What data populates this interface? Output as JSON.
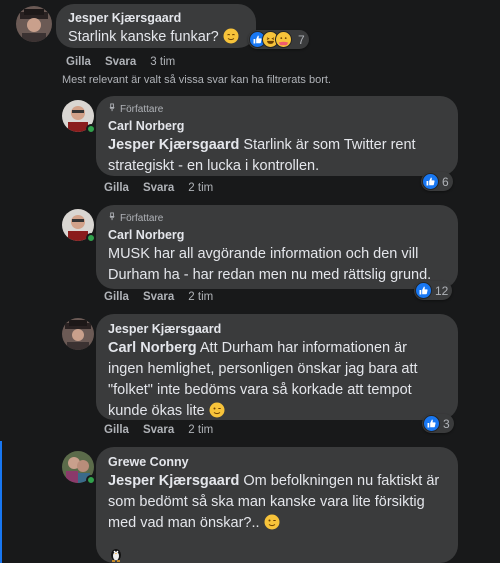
{
  "top_comment": {
    "author": "Jesper Kjærsgaard",
    "text": "Starlink kanske funkar?",
    "reaction_count": "7",
    "reaction_icons": [
      "like-icon",
      "laugh-icon",
      "care-icon"
    ],
    "actions": {
      "like": "Gilla",
      "reply": "Svara",
      "time": "3 tim"
    }
  },
  "filter_notice": "Mest relevant är valt så vissa svar kan ha filtrerats bort.",
  "replies": [
    {
      "badge": "Författare",
      "author": "Carl Norberg",
      "mention": "Jesper Kjærsgaard",
      "text": "Starlink är som Twitter rent strategiskt - en lucka i kontrollen.",
      "reaction_count": "6",
      "actions": {
        "like": "Gilla",
        "reply": "Svara",
        "time": "2 tim"
      }
    },
    {
      "badge": "Författare",
      "author": "Carl Norberg",
      "mention": "",
      "text": "MUSK har all avgörande information och den vill Durham ha - har redan men nu med rättslig grund.",
      "reaction_count": "12",
      "actions": {
        "like": "Gilla",
        "reply": "Svara",
        "time": "2 tim"
      }
    },
    {
      "badge": "",
      "author": "Jesper Kjærsgaard",
      "mention": "Carl Norberg",
      "text": "Att Durham har informationen är ingen hemlighet, personligen önskar jag bara att \"folket\" inte bedöms vara så korkade att tempot kunde ökas lite",
      "reaction_count": "3",
      "actions": {
        "like": "Gilla",
        "reply": "Svara",
        "time": "2 tim"
      }
    },
    {
      "badge": "",
      "author": "Grewe Conny",
      "mention": "Jesper Kjærsgaard",
      "text": "Om befolkningen nu faktiskt är som bedömt så ska man kanske vara lite försiktig med vad man önskar?..",
      "reaction_count": "",
      "actions": {
        "like": "",
        "reply": "",
        "time": ""
      }
    }
  ],
  "colors": {
    "bubble": "#3a3b3c",
    "background": "#18191a",
    "like_blue": "#1877f2",
    "online": "#31a24c"
  }
}
